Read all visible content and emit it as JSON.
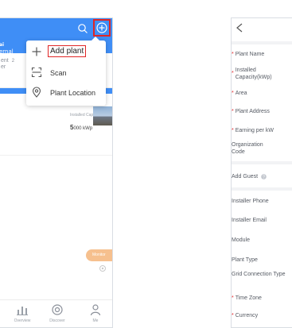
{
  "left_screen": {
    "header_fragment": {
      "line1": "ai",
      "line2": "ernal"
    },
    "summary_fragment": {
      "line1": "ent",
      "line2": "er",
      "count": "2"
    },
    "plant_card": {
      "capacity_label": "Installed Capacity",
      "capacity_value": "5",
      "capacity_unit": "000 kWp"
    },
    "floating_button_label": "Monitor",
    "menu": {
      "items": [
        {
          "label": "Add plant",
          "icon": "plus-icon"
        },
        {
          "label": "Scan",
          "icon": "scan-icon"
        },
        {
          "label": "Plant Location",
          "icon": "location-pin-icon"
        }
      ]
    },
    "tabbar": {
      "tabs": [
        {
          "label": "Overview",
          "icon": "chart-icon"
        },
        {
          "label": "Discover",
          "icon": "discover-icon"
        },
        {
          "label": "Me",
          "icon": "user-icon"
        }
      ]
    },
    "colors": {
      "header": "#3f8ef6",
      "highlight": "#e02626"
    }
  },
  "right_screen": {
    "fields": [
      {
        "label": "Plant Name",
        "required": true
      },
      {
        "label": "Installed Capacity(kWp)",
        "required": true
      },
      {
        "label": "Area",
        "required": true
      },
      {
        "label": "Plant Address",
        "required": true
      },
      {
        "label": "Earning per kW",
        "required": true
      },
      {
        "label": "Organization Code",
        "required": false
      },
      {
        "label": "Add Guest",
        "required": false
      },
      {
        "label": "Installer Phone",
        "required": false
      },
      {
        "label": "Installer Email",
        "required": false
      },
      {
        "label": "Module",
        "required": false
      },
      {
        "label": "Plant Type",
        "required": false
      },
      {
        "label": "Grid Connection Type",
        "required": false
      },
      {
        "label": "Time Zone",
        "required": true
      },
      {
        "label": "Currency",
        "required": true
      }
    ],
    "required_marker": "*"
  }
}
